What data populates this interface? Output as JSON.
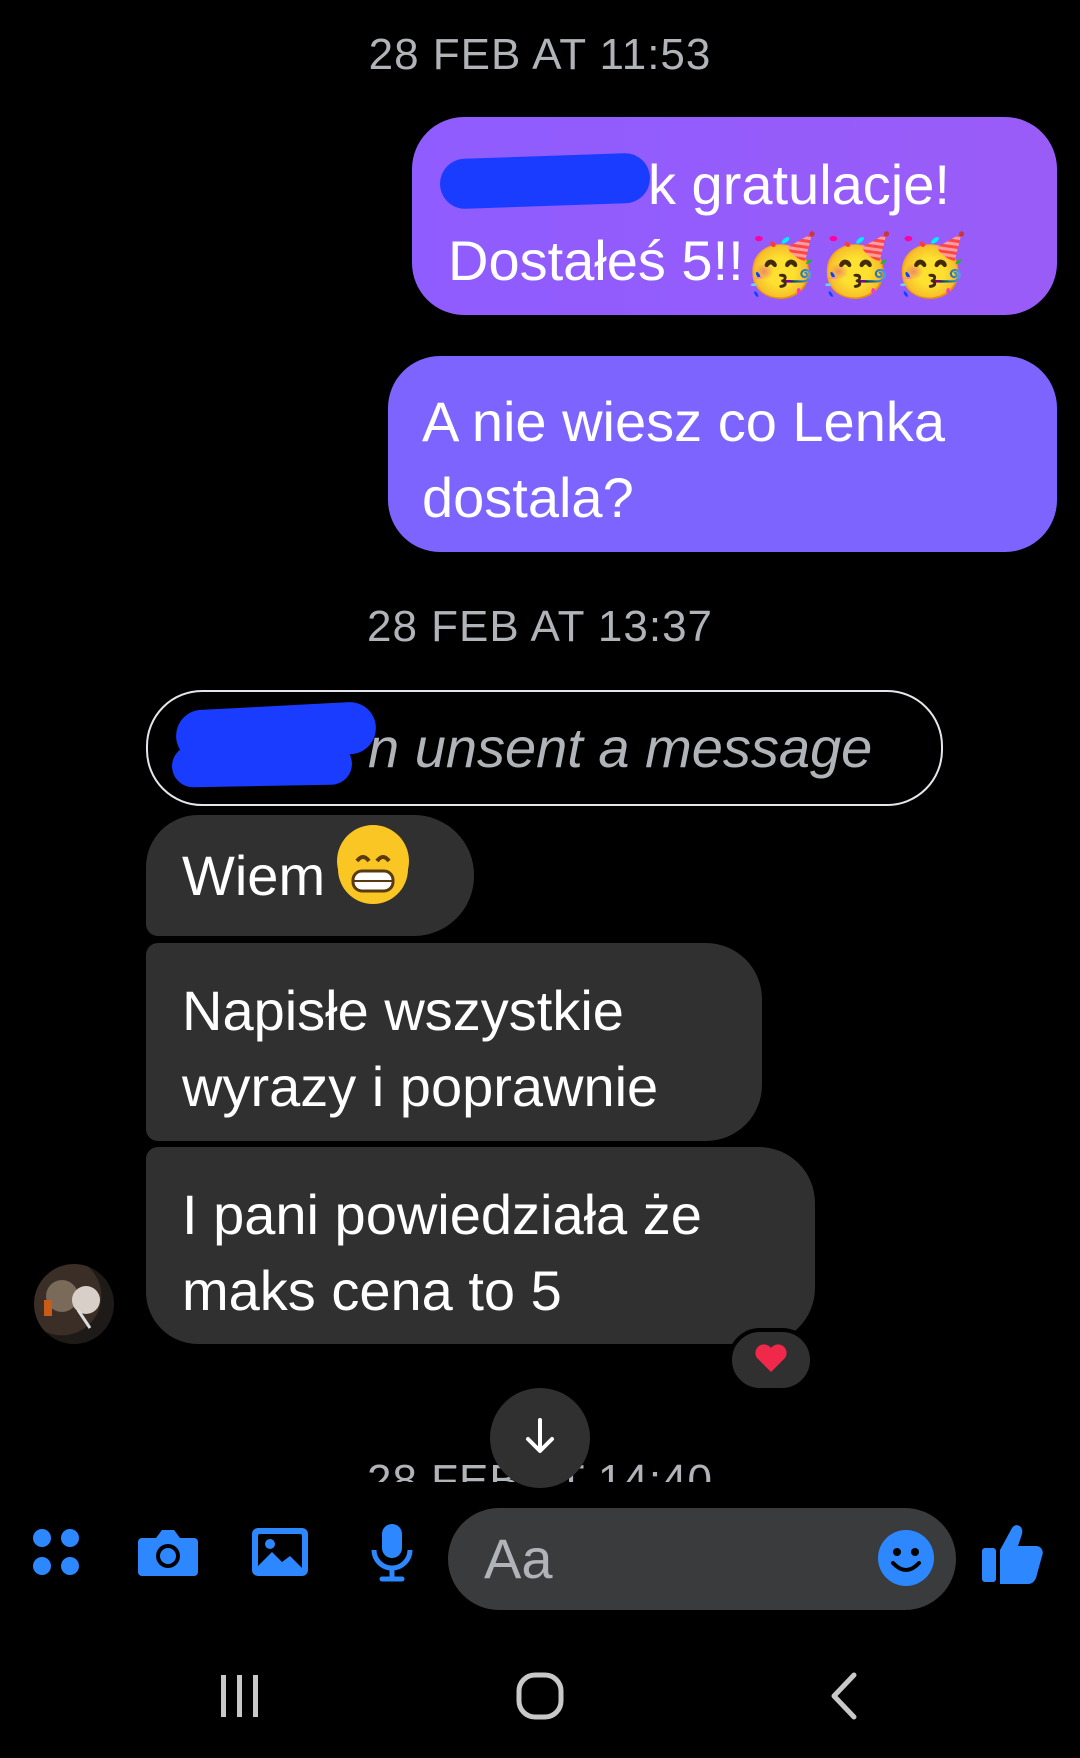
{
  "thread": {
    "timestamp1": "28 FEB AT 11:53",
    "outgoing1_line1": "k gratulacje!",
    "outgoing1_line2": "Dostałeś 5!!",
    "outgoing1_emoji": "🥳🥳🥳",
    "outgoing2": "A nie wiesz co Lenka dostala?",
    "timestamp2": "28 FEB AT 13:37",
    "unsent_notice": "n unsent a message",
    "incoming1": "Wiem",
    "incoming2": "Napisłe wszystkie wyrazy i poprawnie",
    "incoming3": "I pani powiedziała że maks cena to 5",
    "reaction": "❤️",
    "timestamp3_partial": "28 FEB AT 14:40"
  },
  "composer": {
    "placeholder": "Aa",
    "icons": [
      "apps-icon",
      "camera-icon",
      "gallery-icon",
      "microphone-icon",
      "emoji-icon",
      "thumbs-up-icon"
    ]
  },
  "colors": {
    "outgoing_gradient": "#8f5cff",
    "outgoing_solid": "#7d64ff",
    "incoming_bubble": "#303030",
    "accent_blue": "#2d88ff",
    "redaction": "#1a3cff"
  },
  "navigation": {
    "icons": [
      "recent-apps-icon",
      "home-icon",
      "back-icon"
    ]
  }
}
